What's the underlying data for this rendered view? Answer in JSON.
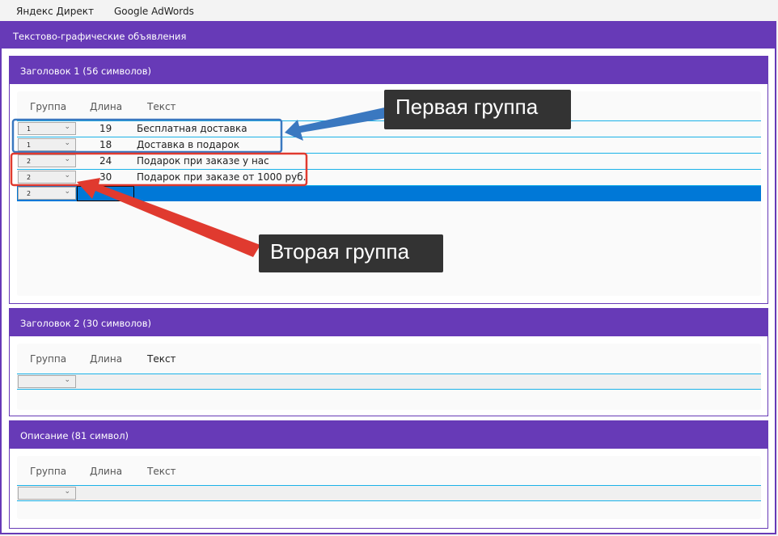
{
  "tabs": [
    {
      "label": "Яндекс Директ",
      "active": true
    },
    {
      "label": "Google AdWords",
      "active": false
    }
  ],
  "panel_title": "Текстово-графические объявления",
  "columns": {
    "group": "Группа",
    "length": "Длина",
    "text": "Текст"
  },
  "sections": [
    {
      "title": "Заголовок 1 (56 символов)",
      "rows": [
        {
          "group": "1",
          "length": "19",
          "text": "Бесплатная доставка"
        },
        {
          "group": "1",
          "length": "18",
          "text": "Доставка в подарок"
        },
        {
          "group": "2",
          "length": "24",
          "text": "Подарок при заказе у нас"
        },
        {
          "group": "2",
          "length": "30",
          "text": "Подарок при заказе от 1000 руб."
        },
        {
          "group": "2",
          "length": "",
          "text": ""
        }
      ]
    },
    {
      "title": "Заголовок 2 (30 символов)",
      "rows": [
        {
          "group": "",
          "length": "",
          "text": ""
        }
      ]
    },
    {
      "title": "Описание (81 символ)",
      "rows": [
        {
          "group": "",
          "length": "",
          "text": ""
        }
      ]
    }
  ],
  "annotations": {
    "first": "Первая группа",
    "second": "Вторая группа",
    "first_color": "#3a78c0",
    "second_color": "#e03a2f"
  },
  "chevron": "⌄",
  "colors": {
    "accent": "#673ab7",
    "selection": "#0078d7",
    "rowline": "#1ab2e8"
  }
}
